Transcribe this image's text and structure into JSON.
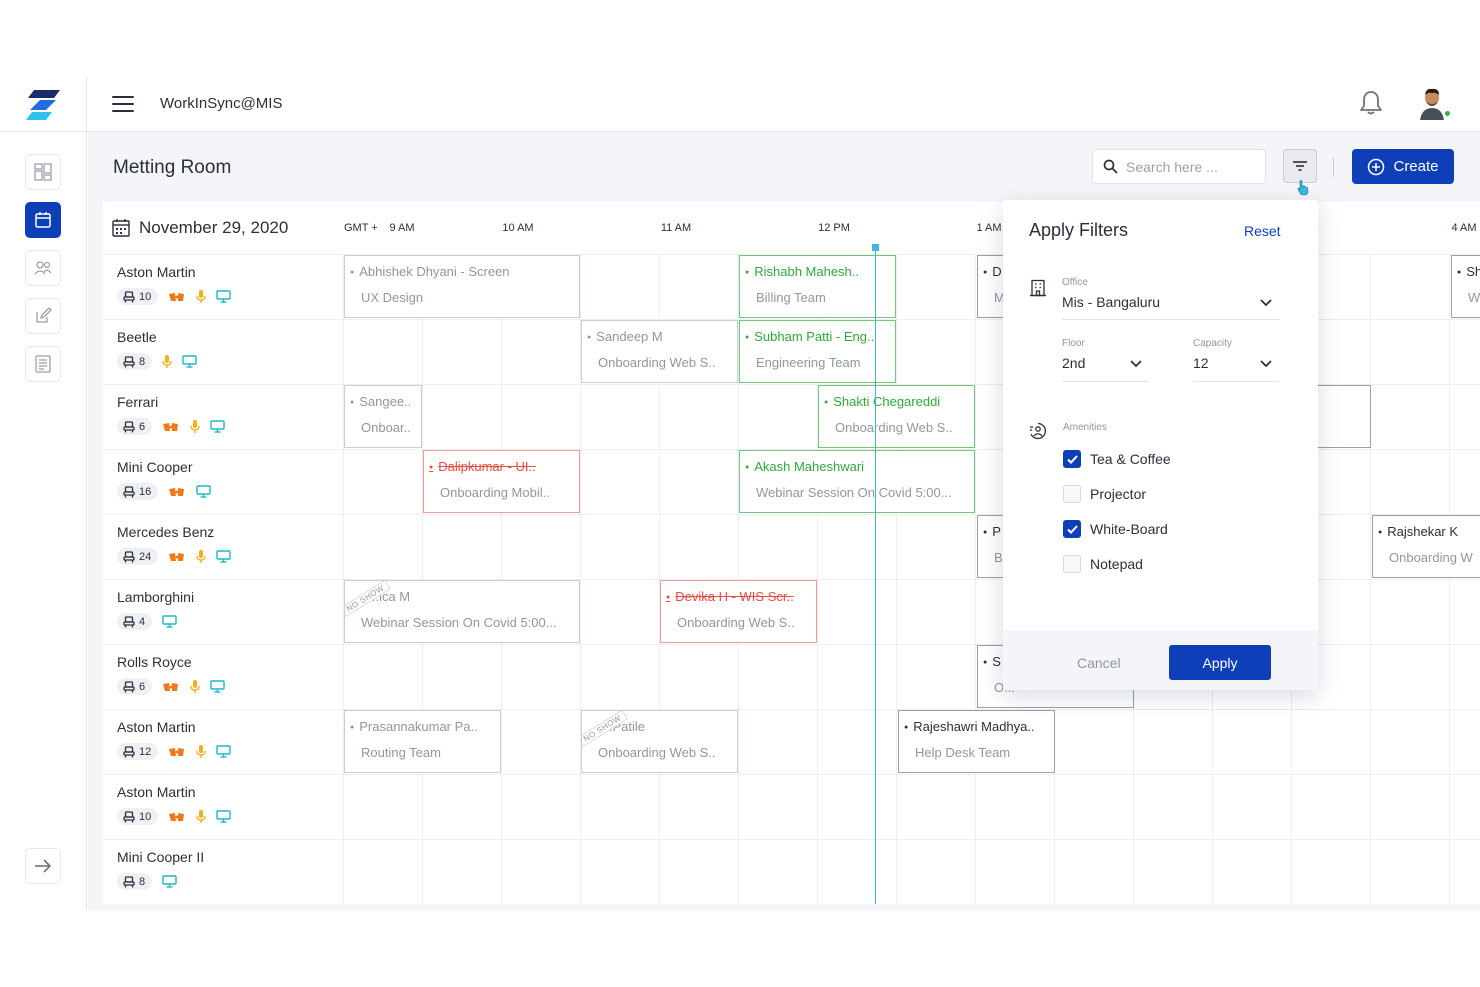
{
  "app": {
    "title": "WorkInSync@MIS"
  },
  "page": {
    "title": "Metting Room"
  },
  "search": {
    "placeholder": "Search here ..."
  },
  "toolbar": {
    "create_label": "Create"
  },
  "calendar": {
    "date": "November 29, 2020",
    "timezone": "GMT +",
    "hours": [
      "9 AM",
      "10 AM",
      "11 AM",
      "12 PM",
      "1 AM",
      "4 AM"
    ]
  },
  "rooms": [
    {
      "name": "Aston Martin",
      "capacity": "10"
    },
    {
      "name": "Beetle",
      "capacity": "8"
    },
    {
      "name": "Ferrari",
      "capacity": "6"
    },
    {
      "name": "Mini Cooper",
      "capacity": "16"
    },
    {
      "name": "Mercedes Benz",
      "capacity": "24"
    },
    {
      "name": "Lamborghini",
      "capacity": "4"
    },
    {
      "name": "Rolls Royce",
      "capacity": "6"
    },
    {
      "name": "Aston Martin",
      "capacity": "12"
    },
    {
      "name": "Aston Martin",
      "capacity": "10"
    },
    {
      "name": "Mini Cooper II",
      "capacity": "8"
    }
  ],
  "events": [
    {
      "title": "Abhishek Dhyani - Screen",
      "sub": "UX Design"
    },
    {
      "title": "Rishabh Mahesh..",
      "sub": "Billing Team"
    },
    {
      "title": "D",
      "sub": "M"
    },
    {
      "title": "Sh",
      "sub": "W"
    },
    {
      "title": "Sandeep M",
      "sub": "Onboarding Web S.."
    },
    {
      "title": "Subham Patti - Eng..",
      "sub": "Engineering Team"
    },
    {
      "title": "Sangee..",
      "sub": "Onboar.."
    },
    {
      "title": "Shakti Chegareddi",
      "sub": "Onboarding Web S.."
    },
    {
      "title": "Dalipkumar - UI..",
      "sub": "Onboarding Mobil.."
    },
    {
      "title": "Akash Maheshwari",
      "sub": "Webinar Session On Covid 5:00..."
    },
    {
      "title": "P",
      "sub": "B"
    },
    {
      "title": "Rajshekar K",
      "sub": "Onboarding W"
    },
    {
      "title": "...ica M",
      "sub": "Webinar Session On Covid 5:00...",
      "badge": "NO SHOW"
    },
    {
      "title": "Devika H - WIS Scr..",
      "sub": "Onboarding Web S.."
    },
    {
      "title": "S",
      "sub": "O..."
    },
    {
      "title": "Prasannakumar Pa..",
      "sub": "Routing Team"
    },
    {
      "title": "..Patile",
      "sub": "Onboarding Web S..",
      "badge": "NO SHOW"
    },
    {
      "title": "Rajeshawri Madhya..",
      "sub": "Help Desk Team"
    }
  ],
  "filters": {
    "title": "Apply Filters",
    "reset_label": "Reset",
    "office": {
      "label": "Office",
      "value": "Mis - Bangaluru"
    },
    "floor": {
      "label": "Floor",
      "value": "2nd"
    },
    "capacity": {
      "label": "Capacity",
      "value": "12"
    },
    "amenities": {
      "label": "Amenities",
      "items": [
        {
          "label": "Tea & Coffee",
          "checked": true
        },
        {
          "label": "Projector",
          "checked": false
        },
        {
          "label": "White-Board",
          "checked": true
        },
        {
          "label": "Notepad",
          "checked": false
        }
      ]
    },
    "cancel_label": "Cancel",
    "apply_label": "Apply"
  },
  "colors": {
    "primary": "#0f3fb8",
    "booked_green": "#2fa83a",
    "cancelled_red": "#e84b40",
    "now_line": "#39b8e0",
    "tea_icon": "#f07a1a",
    "mic_icon": "#f2b01e",
    "screen_icon": "#1fb6c9"
  },
  "icons": [
    "logo-icon",
    "menu-icon",
    "bell-icon",
    "avatar",
    "dashboard-icon",
    "calendar-icon",
    "people-icon",
    "edit-icon",
    "document-icon",
    "arrow-right-icon",
    "search-icon",
    "filter-icon",
    "plus-circle-icon",
    "seat-icon",
    "tea-icon",
    "mic-icon",
    "screen-icon",
    "building-icon",
    "amenities-icon",
    "chevron-down-icon",
    "check-icon"
  ]
}
